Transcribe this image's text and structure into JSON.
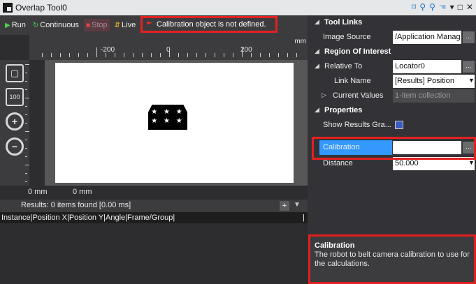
{
  "window": {
    "title": "Overlap Tool0"
  },
  "toolbar": {
    "run_label": "Run",
    "continuous_label": "Continuous",
    "stop_label": "Stop",
    "live_label": "Live",
    "warning_text": "Calibration object is not defined.",
    "warning_color": "#e32020"
  },
  "ruler": {
    "unit": "mm",
    "labels": [
      "-200",
      "0",
      "200"
    ]
  },
  "tools": [
    "fit-screen-icon",
    "zoom-100-icon",
    "zoom-in-icon",
    "zoom-out-icon"
  ],
  "image": {
    "marks": "★ ★ ★"
  },
  "coords": {
    "x": "0 mm",
    "y": "0 mm"
  },
  "results": {
    "summary": "Results: 0 items found [0.00 ms]",
    "columns": "Instance|Position X|Position Y|Angle|Frame/Group|",
    "end_mark": "|"
  },
  "properties": {
    "tool_links": {
      "header": "Tool Links",
      "image_source_label": "Image Source",
      "image_source_value": "/Application Manag"
    },
    "roi": {
      "header": "Region Of Interest",
      "relative_to_label": "Relative To",
      "relative_to_value": "Locator0",
      "link_name_label": "Link Name",
      "link_name_value": "[Results] Position",
      "current_values_label": "Current Values",
      "current_values_value": "1-item collection"
    },
    "props": {
      "header": "Properties",
      "show_results_label": "Show Results Gra...",
      "calibration_label": "Calibration",
      "calibration_value": "",
      "distance_label": "Distance",
      "distance_value": "50.000"
    }
  },
  "description": {
    "title": "Calibration",
    "text": "The robot to belt camera calibration to use for the calculations."
  },
  "colors": {
    "accent": "#3399ff",
    "highlight": "#e32020",
    "panel": "#333337"
  }
}
